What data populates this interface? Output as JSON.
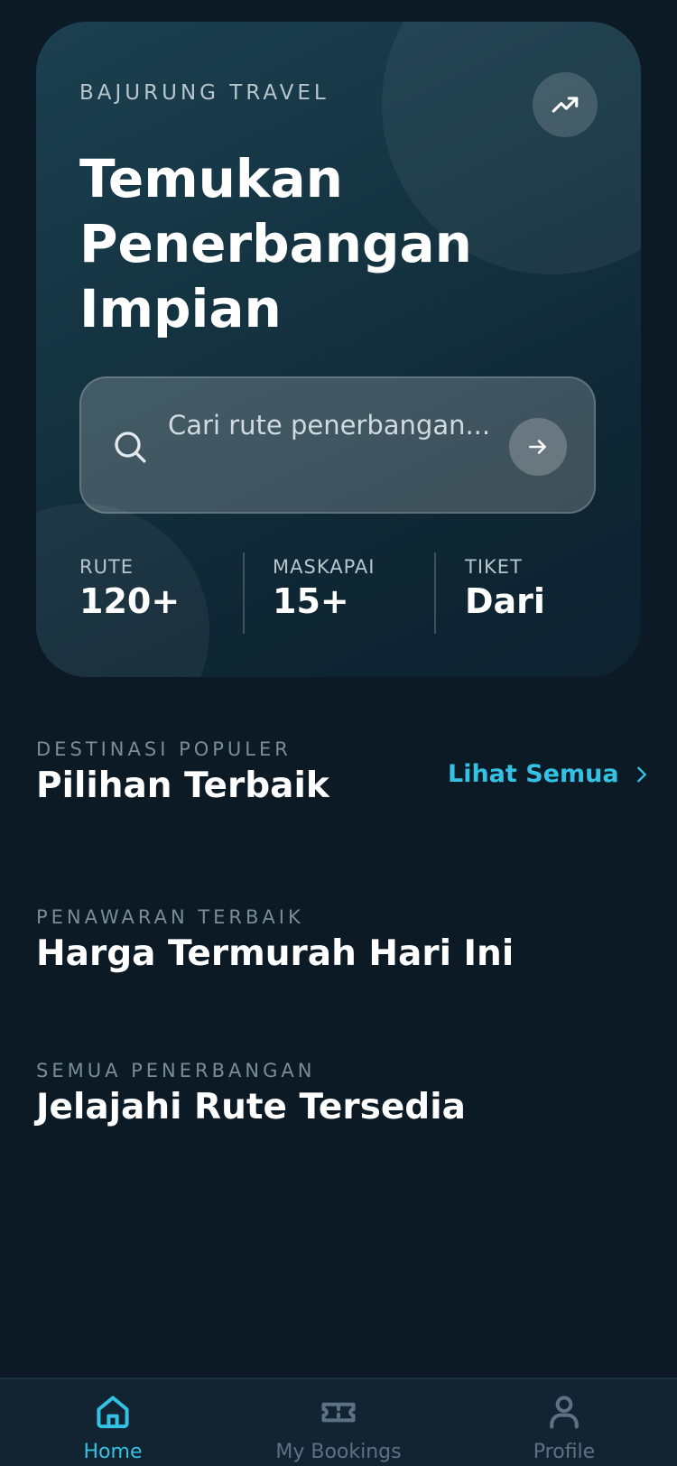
{
  "hero": {
    "brand": "BAJURUNG TRAVEL",
    "title_line1": "Temukan",
    "title_line2": "Penerbangan",
    "title_line3": "Impian",
    "search": {
      "placeholder": "Cari rute penerbangan..."
    },
    "stats": [
      {
        "label": "RUTE",
        "value": "120+"
      },
      {
        "label": "MASKAPAI",
        "value": "15+"
      },
      {
        "label": "TIKET",
        "value": "Dari"
      }
    ]
  },
  "sections": {
    "popular": {
      "kicker": "DESTINASI POPULER",
      "title": "Pilihan Terbaik",
      "see_all": "Lihat Semua"
    },
    "deals": {
      "kicker": "PENAWARAN TERBAIK",
      "title": "Harga Termurah Hari Ini"
    },
    "all_flights": {
      "kicker": "SEMUA PENERBANGAN",
      "title": "Jelajahi Rute Tersedia"
    }
  },
  "nav": {
    "items": [
      {
        "label": "Home",
        "icon": "home-icon",
        "active": true
      },
      {
        "label": "My Bookings",
        "icon": "ticket-icon",
        "active": false
      },
      {
        "label": "Profile",
        "icon": "user-icon",
        "active": false
      }
    ]
  },
  "colors": {
    "background": "#0b1a24",
    "accent": "#33c2e3",
    "hero_top": "#1c4050",
    "hero_bottom": "#0e2230",
    "nav_background": "#122331"
  }
}
